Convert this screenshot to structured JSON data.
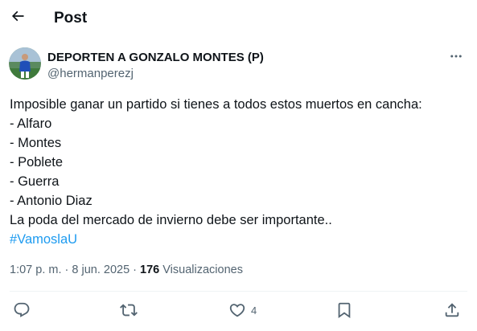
{
  "header": {
    "title": "Post",
    "back_icon": "arrow-left-icon"
  },
  "author": {
    "name": "DEPORTEN A GONZALO MONTES (P)",
    "handle": "@hermanperezj",
    "avatar_icon": "avatar"
  },
  "tweet": {
    "lines": [
      "Imposible ganar un partido si tienes a todos estos muertos en cancha:",
      "- Alfaro",
      "- Montes",
      "- Poblete",
      "- Guerra",
      "- Antonio Diaz",
      "La poda del mercado de invierno debe ser importante.."
    ],
    "hashtag": "#VamoslaU"
  },
  "meta": {
    "time": "1:07 p. m.",
    "separator": " · ",
    "date": "8 jun. 2025",
    "views_count": "176",
    "views_label": "Visualizaciones"
  },
  "actions": {
    "reply_icon": "reply-icon",
    "retweet_icon": "retweet-icon",
    "like_icon": "heart-icon",
    "like_count": "4",
    "bookmark_icon": "bookmark-icon",
    "share_icon": "share-icon"
  },
  "colors": {
    "text": "#0f1419",
    "secondary": "#536471",
    "link": "#1d9bf0",
    "divider": "#eff3f4",
    "avatar_bg": "#3b6f4a"
  }
}
